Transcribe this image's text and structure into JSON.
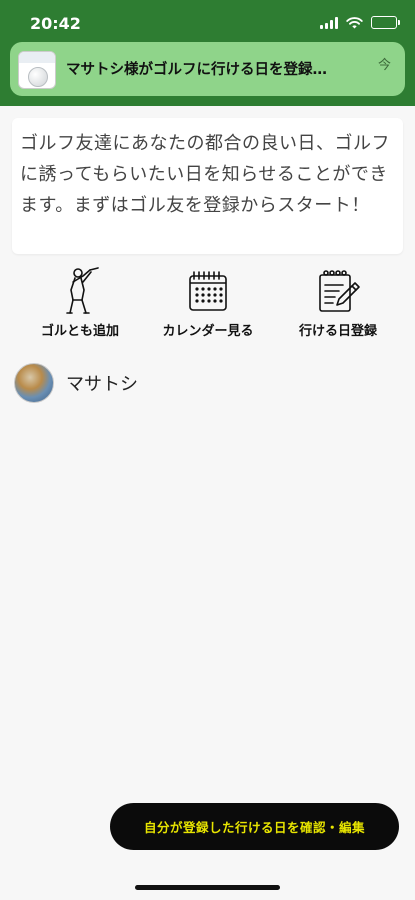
{
  "status": {
    "time": "20:42"
  },
  "notification": {
    "title": "マサトシ様がゴルフに行ける日を登録…",
    "time": "今",
    "app_icon": "app-icon-golf-ball"
  },
  "intro": {
    "text": "ゴルフ友達にあなたの都合の良い日、ゴルフに誘ってもらいたい日を知らせることができます。まずはゴル友を登録からスタート！"
  },
  "actions": [
    {
      "label": "ゴルとも追加",
      "icon": "golfer-icon"
    },
    {
      "label": "カレンダー見る",
      "icon": "calendar-icon"
    },
    {
      "label": "行ける日登録",
      "icon": "notepad-pen-icon"
    }
  ],
  "friends": [
    {
      "name": "マサトシ",
      "icon": "avatar"
    }
  ],
  "fab": {
    "label": "自分が登録した行ける日を確認・編集"
  },
  "colors": {
    "header_green": "#2e7d32",
    "notification_green": "#8fd48a",
    "fab_bg": "#0b0b0b",
    "fab_text": "#e8e500"
  }
}
